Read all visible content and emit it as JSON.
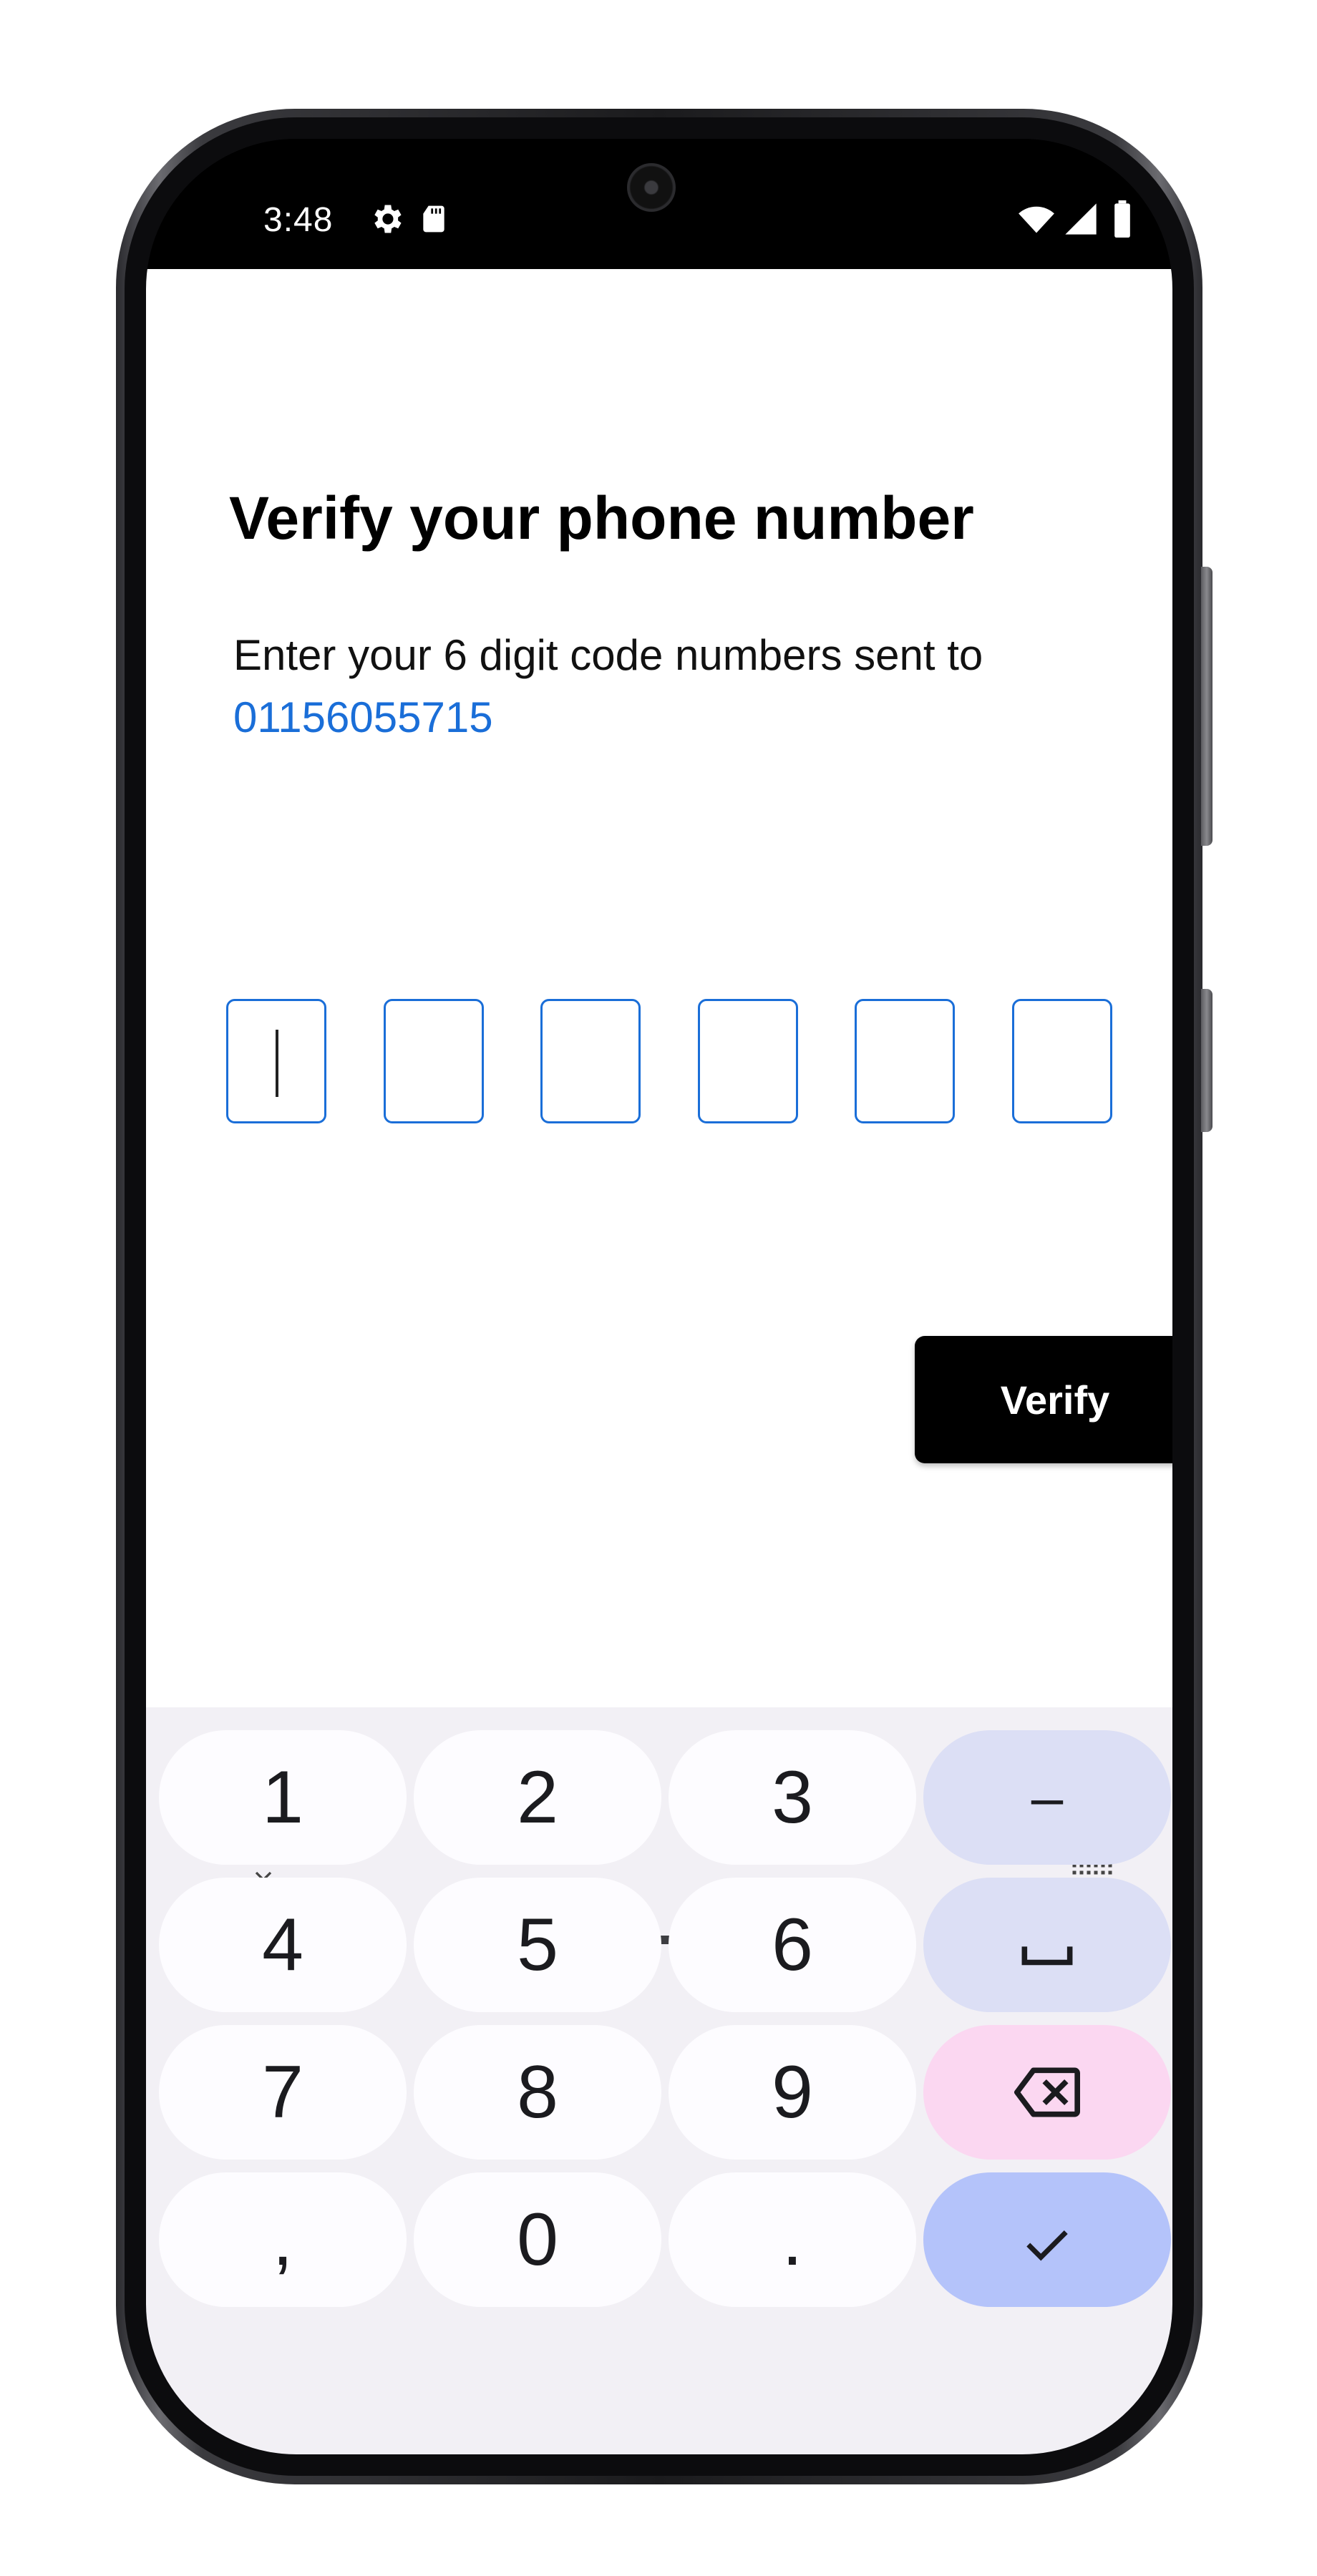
{
  "status_bar": {
    "time": "3:48",
    "icons": [
      "settings-icon",
      "sd-card-icon",
      "wifi-icon",
      "signal-icon",
      "battery-icon"
    ]
  },
  "verify_screen": {
    "title": "Verify your phone number",
    "subtitle": "Enter your 6 digit code numbers sent to",
    "phone_number": "01156055715",
    "otp_digits": [
      "",
      "",
      "",
      "",
      "",
      ""
    ],
    "verify_label": "Verify"
  },
  "keyboard": {
    "rows": [
      [
        {
          "label": "1",
          "type": "digit"
        },
        {
          "label": "2",
          "type": "digit"
        },
        {
          "label": "3",
          "type": "digit"
        },
        {
          "label": "–",
          "type": "fn",
          "name": "dash-key"
        }
      ],
      [
        {
          "label": "4",
          "type": "digit"
        },
        {
          "label": "5",
          "type": "digit"
        },
        {
          "label": "6",
          "type": "digit"
        },
        {
          "label": "␣",
          "type": "fn",
          "name": "space-key"
        }
      ],
      [
        {
          "label": "7",
          "type": "digit"
        },
        {
          "label": "8",
          "type": "digit"
        },
        {
          "label": "9",
          "type": "digit"
        },
        {
          "label": "",
          "type": "del",
          "name": "backspace-key"
        }
      ],
      [
        {
          "label": ",",
          "type": "digit"
        },
        {
          "label": "0",
          "type": "digit"
        },
        {
          "label": ".",
          "type": "digit"
        },
        {
          "label": "",
          "type": "enter",
          "name": "done-key"
        }
      ]
    ],
    "bottom_icons": [
      "chevron-down-icon",
      "keyboard-icon"
    ]
  },
  "colors": {
    "accent": "#1a6ed8",
    "keyboard_bg": "#f2f0f5",
    "key_fn": "#dcdff5",
    "key_delete": "#fbd7f1",
    "key_enter": "#b4c3fa"
  }
}
